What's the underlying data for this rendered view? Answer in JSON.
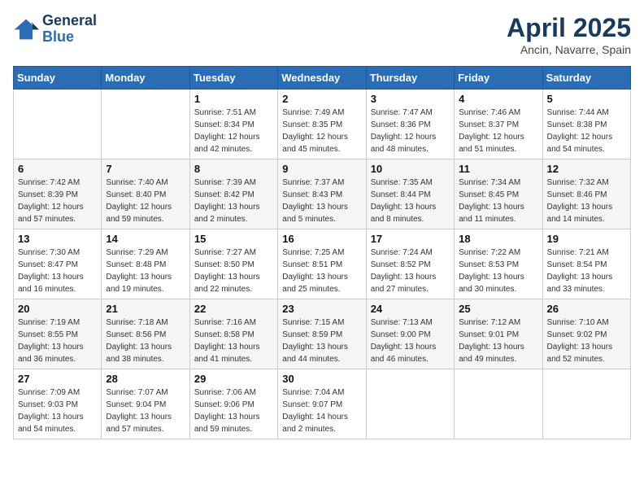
{
  "header": {
    "logo_line1": "General",
    "logo_line2": "Blue",
    "title": "April 2025",
    "subtitle": "Ancin, Navarre, Spain"
  },
  "weekdays": [
    "Sunday",
    "Monday",
    "Tuesday",
    "Wednesday",
    "Thursday",
    "Friday",
    "Saturday"
  ],
  "weeks": [
    [
      {
        "day": "",
        "info": ""
      },
      {
        "day": "",
        "info": ""
      },
      {
        "day": "1",
        "info": "Sunrise: 7:51 AM\nSunset: 8:34 PM\nDaylight: 12 hours and 42 minutes."
      },
      {
        "day": "2",
        "info": "Sunrise: 7:49 AM\nSunset: 8:35 PM\nDaylight: 12 hours and 45 minutes."
      },
      {
        "day": "3",
        "info": "Sunrise: 7:47 AM\nSunset: 8:36 PM\nDaylight: 12 hours and 48 minutes."
      },
      {
        "day": "4",
        "info": "Sunrise: 7:46 AM\nSunset: 8:37 PM\nDaylight: 12 hours and 51 minutes."
      },
      {
        "day": "5",
        "info": "Sunrise: 7:44 AM\nSunset: 8:38 PM\nDaylight: 12 hours and 54 minutes."
      }
    ],
    [
      {
        "day": "6",
        "info": "Sunrise: 7:42 AM\nSunset: 8:39 PM\nDaylight: 12 hours and 57 minutes."
      },
      {
        "day": "7",
        "info": "Sunrise: 7:40 AM\nSunset: 8:40 PM\nDaylight: 12 hours and 59 minutes."
      },
      {
        "day": "8",
        "info": "Sunrise: 7:39 AM\nSunset: 8:42 PM\nDaylight: 13 hours and 2 minutes."
      },
      {
        "day": "9",
        "info": "Sunrise: 7:37 AM\nSunset: 8:43 PM\nDaylight: 13 hours and 5 minutes."
      },
      {
        "day": "10",
        "info": "Sunrise: 7:35 AM\nSunset: 8:44 PM\nDaylight: 13 hours and 8 minutes."
      },
      {
        "day": "11",
        "info": "Sunrise: 7:34 AM\nSunset: 8:45 PM\nDaylight: 13 hours and 11 minutes."
      },
      {
        "day": "12",
        "info": "Sunrise: 7:32 AM\nSunset: 8:46 PM\nDaylight: 13 hours and 14 minutes."
      }
    ],
    [
      {
        "day": "13",
        "info": "Sunrise: 7:30 AM\nSunset: 8:47 PM\nDaylight: 13 hours and 16 minutes."
      },
      {
        "day": "14",
        "info": "Sunrise: 7:29 AM\nSunset: 8:48 PM\nDaylight: 13 hours and 19 minutes."
      },
      {
        "day": "15",
        "info": "Sunrise: 7:27 AM\nSunset: 8:50 PM\nDaylight: 13 hours and 22 minutes."
      },
      {
        "day": "16",
        "info": "Sunrise: 7:25 AM\nSunset: 8:51 PM\nDaylight: 13 hours and 25 minutes."
      },
      {
        "day": "17",
        "info": "Sunrise: 7:24 AM\nSunset: 8:52 PM\nDaylight: 13 hours and 27 minutes."
      },
      {
        "day": "18",
        "info": "Sunrise: 7:22 AM\nSunset: 8:53 PM\nDaylight: 13 hours and 30 minutes."
      },
      {
        "day": "19",
        "info": "Sunrise: 7:21 AM\nSunset: 8:54 PM\nDaylight: 13 hours and 33 minutes."
      }
    ],
    [
      {
        "day": "20",
        "info": "Sunrise: 7:19 AM\nSunset: 8:55 PM\nDaylight: 13 hours and 36 minutes."
      },
      {
        "day": "21",
        "info": "Sunrise: 7:18 AM\nSunset: 8:56 PM\nDaylight: 13 hours and 38 minutes."
      },
      {
        "day": "22",
        "info": "Sunrise: 7:16 AM\nSunset: 8:58 PM\nDaylight: 13 hours and 41 minutes."
      },
      {
        "day": "23",
        "info": "Sunrise: 7:15 AM\nSunset: 8:59 PM\nDaylight: 13 hours and 44 minutes."
      },
      {
        "day": "24",
        "info": "Sunrise: 7:13 AM\nSunset: 9:00 PM\nDaylight: 13 hours and 46 minutes."
      },
      {
        "day": "25",
        "info": "Sunrise: 7:12 AM\nSunset: 9:01 PM\nDaylight: 13 hours and 49 minutes."
      },
      {
        "day": "26",
        "info": "Sunrise: 7:10 AM\nSunset: 9:02 PM\nDaylight: 13 hours and 52 minutes."
      }
    ],
    [
      {
        "day": "27",
        "info": "Sunrise: 7:09 AM\nSunset: 9:03 PM\nDaylight: 13 hours and 54 minutes."
      },
      {
        "day": "28",
        "info": "Sunrise: 7:07 AM\nSunset: 9:04 PM\nDaylight: 13 hours and 57 minutes."
      },
      {
        "day": "29",
        "info": "Sunrise: 7:06 AM\nSunset: 9:06 PM\nDaylight: 13 hours and 59 minutes."
      },
      {
        "day": "30",
        "info": "Sunrise: 7:04 AM\nSunset: 9:07 PM\nDaylight: 14 hours and 2 minutes."
      },
      {
        "day": "",
        "info": ""
      },
      {
        "day": "",
        "info": ""
      },
      {
        "day": "",
        "info": ""
      }
    ]
  ]
}
